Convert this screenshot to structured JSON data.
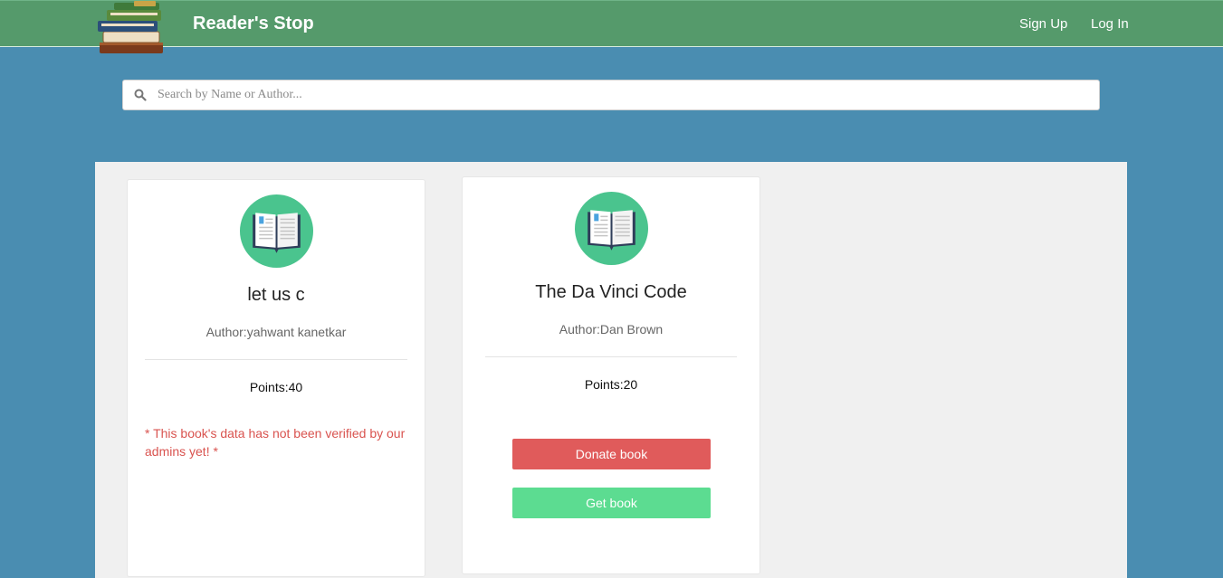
{
  "header": {
    "brand": "Reader's Stop",
    "nav": {
      "signup": "Sign Up",
      "login": "Log In"
    }
  },
  "search": {
    "placeholder": "Search by Name or Author...",
    "value": ""
  },
  "books": [
    {
      "title": "let us c",
      "author": "Author:yahwant kanetkar",
      "points": "Points:40",
      "warning": "* This book's data has not been verified by our admins yet! *"
    },
    {
      "title": "The Da Vinci Code",
      "author": "Author:Dan Brown",
      "points": "Points:20",
      "donate_label": "Donate book",
      "get_label": "Get book"
    }
  ],
  "colors": {
    "header_bg": "#559a6b",
    "page_bg": "#4a8db1",
    "icon_circle": "#4ac48e",
    "donate": "#e05b5b",
    "get": "#5cdc91",
    "warning": "#d9534f"
  },
  "icons": {
    "logo": "book-stack-logo",
    "search": "search-icon",
    "book": "open-book-icon"
  }
}
